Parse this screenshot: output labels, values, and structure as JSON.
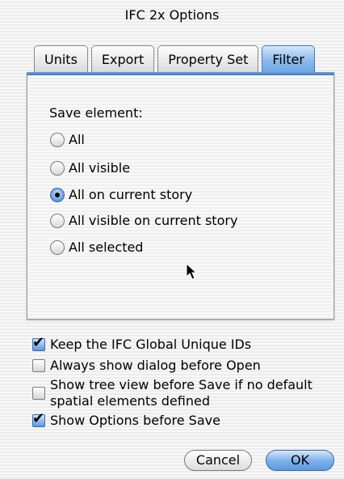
{
  "window": {
    "title": "IFC 2x Options"
  },
  "tabs": [
    {
      "label": "Units",
      "selected": false
    },
    {
      "label": "Export",
      "selected": false
    },
    {
      "label": "Property Set",
      "selected": false
    },
    {
      "label": "Filter",
      "selected": true
    }
  ],
  "filter": {
    "section_label": "Save element:",
    "options": [
      {
        "label": "All",
        "selected": false
      },
      {
        "label": "All visible",
        "selected": false
      },
      {
        "label": "All on current story",
        "selected": true
      },
      {
        "label": "All visible on current story",
        "selected": false
      },
      {
        "label": "All selected",
        "selected": false
      }
    ]
  },
  "checkboxes": [
    {
      "label": "Keep the IFC Global Unique IDs",
      "checked": true
    },
    {
      "label": "Always show dialog before Open",
      "checked": false
    },
    {
      "label_line1": "Show tree view before Save if no default",
      "label_line2": "spatial elements defined",
      "checked": false
    },
    {
      "label": "Show Options before Save",
      "checked": true
    }
  ],
  "buttons": {
    "cancel": "Cancel",
    "ok": "OK"
  },
  "colors": {
    "accent": "#6ea5e4",
    "accent_dark": "#3a6aa8"
  }
}
